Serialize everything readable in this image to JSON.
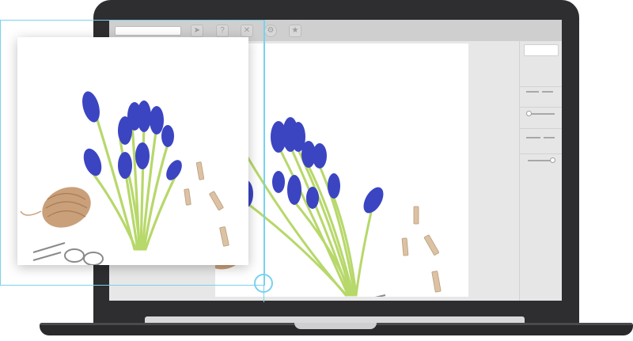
{
  "scene": "laptop-photo-editor-magnifier",
  "colors": {
    "laptop_body": "#2e2e30",
    "screen_bg": "#f3f3f3",
    "toolbar": "#cfcfcf",
    "panel": "#e6e6e6",
    "zoom_accent": "#78d2ee",
    "flower_blue": "#3b45c2",
    "stem_green": "#b7d86a",
    "twine": "#c9a07a"
  },
  "toolbar": {
    "buttons": [
      {
        "icon": "send-icon",
        "glyph": "➤"
      },
      {
        "icon": "help-icon",
        "glyph": "?"
      },
      {
        "icon": "close-icon",
        "glyph": "✕"
      },
      {
        "icon": "settings-icon",
        "glyph": "⚙"
      },
      {
        "icon": "star-icon",
        "glyph": "★"
      }
    ]
  },
  "panel": {
    "sections": [
      "swatch",
      "divider",
      "slider",
      "divider",
      "slider"
    ]
  }
}
